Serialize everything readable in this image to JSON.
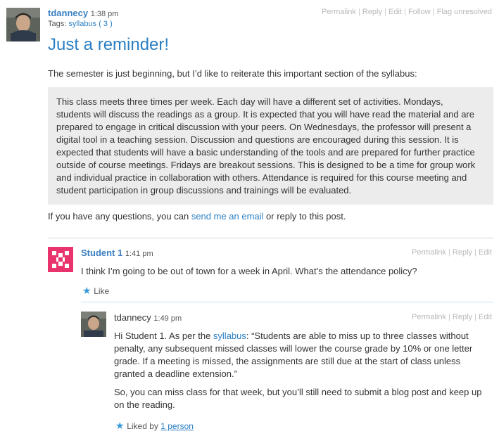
{
  "post": {
    "author": "tdannecy",
    "time": "1:38 pm",
    "tags_prefix": "Tags:",
    "tag_link": "syllabus",
    "tag_count": "( 3 )",
    "actions": [
      "Permalink",
      "Reply",
      "Edit",
      "Follow",
      "Flag unresolved"
    ],
    "title": "Just a reminder!",
    "intro": "The semester is just beginning, but I’d like to reiterate this important section of the syllabus:",
    "quote_lines": [
      "This class meets three times per week. Each day will have a different set of activities. Mondays,",
      "students will discuss the readings as a group. It is expected that you will have read the material and are",
      "prepared to engage in critical discussion with your peers. On Wednesdays, the professor will present a",
      "digital tool in a teaching session. Discussion and questions are encouraged during this session. It is",
      "expected that students will have a basic understanding of the tools and are prepared for further practice",
      "outside of course meetings. Fridays are breakout sessions. This is designed to be a time for group work",
      "and individual practice in collaboration with others. Attendance is required for this course meeting and",
      "student participation in group discussions and trainings will be evaluated."
    ],
    "outro_before": "If you have any questions, you can ",
    "outro_link": "send me an email",
    "outro_after": " or reply to this post."
  },
  "reply1": {
    "author": "Student 1",
    "time": "1:41 pm",
    "actions": [
      "Permalink",
      "Reply",
      "Edit"
    ],
    "text": "I think I’m going to be out of town for a week in April. What’s the attendance policy?",
    "like_label": "Like"
  },
  "reply2": {
    "author": "tdannecy",
    "time": "1:49 pm",
    "actions": [
      "Permalink",
      "Reply",
      "Edit"
    ],
    "line1_before": "Hi Student 1. As per the ",
    "line1_link": "syllabus",
    "line1_after": ": “Students are able to miss up to three classes without",
    "lines": [
      "penalty, any subsequent missed classes will lower the course grade by 10% or one letter",
      "grade. If a meeting is missed, the assignments are still due at the start of class unless",
      "granted a deadline extension.”"
    ],
    "para2_lines": [
      "So, you can miss class for that week, but you’ll still need to submit a blog post and keep up",
      "on the reading."
    ],
    "liked_by_prefix": "Liked by ",
    "liked_by_link": "1 person"
  },
  "colors": {
    "link": "#2a7fc4",
    "quote_bg": "#ececec",
    "identicon": "#e8336d",
    "star": "#3498db"
  },
  "icons": [
    "avatar-photo",
    "identicon-avatar",
    "star-icon"
  ]
}
